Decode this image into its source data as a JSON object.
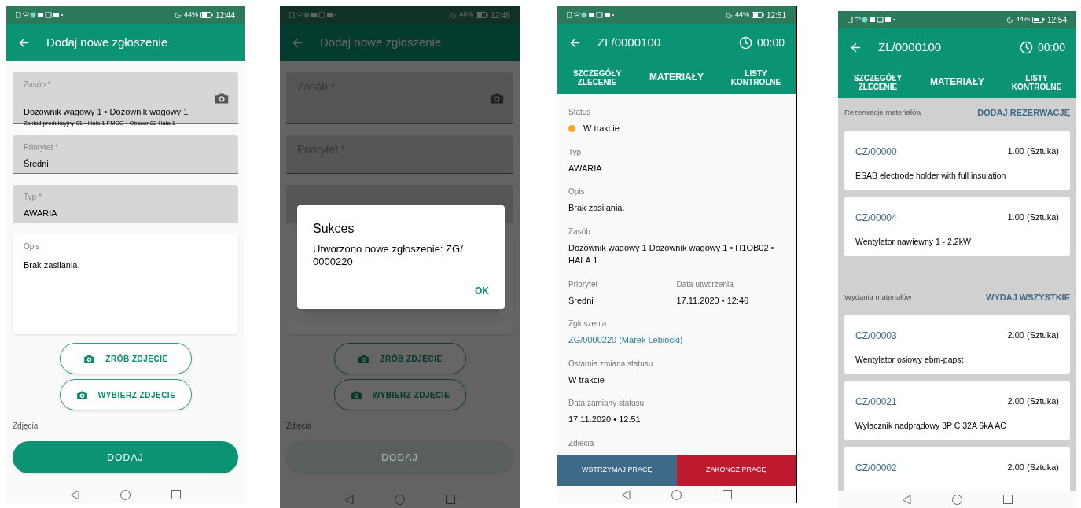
{
  "phones": [
    {
      "kind": "form",
      "status": {
        "battery": "44%",
        "time": "12:44"
      },
      "dimmed": false,
      "header": {
        "title": "Dodaj nowe zgłoszenie"
      },
      "fields": [
        {
          "label": "Zasób *",
          "value": "Dozownik wagowy 1 • Dozownik wagowy 1",
          "sub": "Zakład produkcyjny 01  •  Hala 1 FMCG  •  Obszar 02 Hala 1",
          "camera": true
        },
        {
          "label": "Priorytet *",
          "value": "Średni",
          "camera": false
        },
        {
          "label": "Typ *",
          "value": "AWARIA",
          "camera": false
        }
      ],
      "description": {
        "label": "Opis",
        "value": "Brak zasilania."
      },
      "photo_buttons": [
        "ZRÓB ZDJĘCIE",
        "WYBIERZ ZDJĘCIE"
      ],
      "photos_label": "Zdjęcia",
      "submit": {
        "label": "DODAJ",
        "disabled": false
      }
    },
    {
      "kind": "form",
      "status": {
        "battery": "44%",
        "time": "12:45"
      },
      "dimmed": true,
      "header": {
        "title": "Dodaj nowe zgłoszenie"
      },
      "fields": [
        {
          "label": "Zasób *",
          "camera": true
        },
        {
          "label": "Priorytet *",
          "camera": false
        }
      ],
      "dialog": {
        "title": "Sukces",
        "message": "Utworzono nowe zgłoszenie: ZG/ 0000220",
        "button": "OK"
      },
      "photo_buttons": [
        "ZRÓB ZDJĘCIE",
        "WYBIERZ ZDJĘCIE"
      ],
      "photos_label": "Zdjęcia",
      "submit": {
        "label": "DODAJ",
        "disabled": true
      }
    },
    {
      "kind": "details",
      "status": {
        "battery": "44%",
        "time": "12:51"
      },
      "dimmed": false,
      "header": {
        "title": "ZL/0000100",
        "timer": "00:00"
      },
      "tabs": [
        "SZCZEGÓŁY ZLECENIE",
        "MATERIAŁY",
        "LISTY KONTROLNE"
      ],
      "details": [
        {
          "kind": "status",
          "label": "Status",
          "value": "W trakcie",
          "color": "#f5a623"
        },
        {
          "kind": "text",
          "label": "Typ",
          "value": "AWARIA"
        },
        {
          "kind": "text",
          "label": "Opis",
          "value": "Brak zasilania."
        },
        {
          "kind": "text",
          "label": "Zasób",
          "value": "Dozownik wagowy 1 Dozownik wagowy 1 • H1OB02 • HALA 1"
        },
        {
          "kind": "pair",
          "cells": [
            {
              "label": "Priorytet",
              "value": "Średni"
            },
            {
              "label": "Data utworzenia",
              "value": "17.11.2020 • 12:46"
            }
          ]
        },
        {
          "kind": "link",
          "label": "Zgłoszenia",
          "value": "ZG/0000220 (Marek Lebiocki)"
        },
        {
          "kind": "text",
          "label": "Ostatnia zmiana statusu",
          "value": "W trakcie"
        },
        {
          "kind": "text",
          "label": "Data zamiany statusu",
          "value": "17.11.2020 • 12:51"
        },
        {
          "kind": "text",
          "label": "Zdiecia"
        }
      ],
      "actions": [
        {
          "label": "WSTRZYMAJ PRACĘ",
          "color": "#3e6a88"
        },
        {
          "label": "ZAKOŃCZ PRACĘ",
          "color": "#be1a2f"
        }
      ]
    },
    {
      "kind": "materials",
      "status": {
        "battery": "44%",
        "time": "12:54"
      },
      "dimmed": false,
      "header": {
        "title": "ZL/0000100",
        "timer": "00:00"
      },
      "tabs": [
        "SZCZEGÓŁY ZLECENIE",
        "MATERIAŁY",
        "LISTY KONTROLNE"
      ],
      "sections": [
        {
          "title": "Rezerwacje materiałów",
          "action": "DODAJ REZERWACJĘ",
          "items": [
            {
              "code": "CZ/00000",
              "quantity": "1.00 (Sztuka)",
              "name": "ESAB electrode holder with full insulation"
            },
            {
              "code": "CZ/00004",
              "quantity": "1.00 (Sztuka)",
              "name": "Wentylator nawiewny 1 - 2.2kW"
            }
          ]
        },
        {
          "title": "Wydania materiałów",
          "action": "WYDAJ WSZYSTKIE",
          "items": [
            {
              "code": "CZ/00003",
              "quantity": "2.00 (Sztuka)",
              "name": "Wentylator osiowy ebm-papst"
            },
            {
              "code": "CZ/00021",
              "quantity": "2.00 (Sztuka)",
              "name": "Wyłącznik nadprądowy 3P C 32A 6kA AC"
            },
            {
              "code": "CZ/00002",
              "quantity": "2.00 (Sztuka)"
            }
          ]
        }
      ]
    }
  ]
}
